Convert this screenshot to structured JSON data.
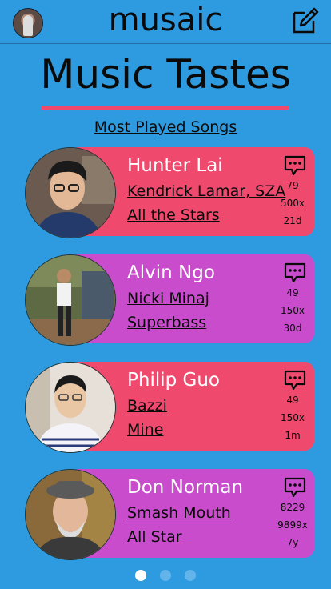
{
  "app": {
    "title": "musaic"
  },
  "page": {
    "heading": "Music Tastes",
    "subheading": "Most Played Songs"
  },
  "colors": {
    "background": "#2e9be0",
    "card_pink": "#ef4a6e",
    "card_purple": "#c84ccc",
    "accent_rule": "#ef4a6e"
  },
  "icons": {
    "avatar": "user-avatar",
    "compose": "compose-icon",
    "message": "message-bubble-icon"
  },
  "users": [
    {
      "name": "Hunter Lai",
      "artist": "Kendrick Lamar, SZA",
      "song": "All the Stars",
      "comments": "79",
      "plays": "500x",
      "age": "21d",
      "color": "#ef4a6e"
    },
    {
      "name": "Alvin Ngo",
      "artist": "Nicki Minaj",
      "song": "Superbass",
      "comments": "49",
      "plays": "150x",
      "age": "30d",
      "color": "#c84ccc"
    },
    {
      "name": "Philip Guo",
      "artist": "Bazzi",
      "song": "Mine",
      "comments": "49",
      "plays": "150x",
      "age": "1m",
      "color": "#ef4a6e"
    },
    {
      "name": "Don Norman",
      "artist": "Smash Mouth",
      "song": "All Star",
      "comments": "8229",
      "plays": "9899x",
      "age": "7y",
      "color": "#c84ccc"
    }
  ],
  "pagination": {
    "pages": 3,
    "current": 1
  }
}
